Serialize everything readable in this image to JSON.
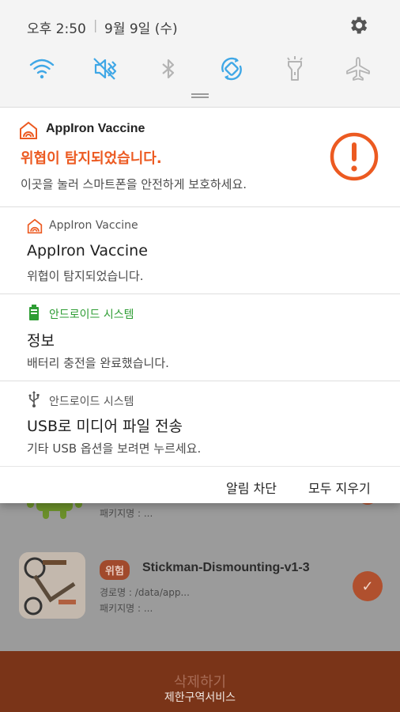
{
  "status_bar": {
    "time": "오후 2:50",
    "separator": "|",
    "date": "9월 9일 (수)"
  },
  "quick_settings": {
    "items": [
      {
        "icon": "wifi-icon",
        "active": true
      },
      {
        "icon": "sound-mute-icon",
        "active": true
      },
      {
        "icon": "bluetooth-icon",
        "active": false
      },
      {
        "icon": "auto-rotate-icon",
        "active": true
      },
      {
        "icon": "flashlight-icon",
        "active": false
      },
      {
        "icon": "airplane-mode-icon",
        "active": false
      }
    ],
    "active_color": "#3fa7e6",
    "inactive_color": "#b4b4b4"
  },
  "notifications": [
    {
      "app": "AppIron Vaccine",
      "title": "위협이 탐지되었습니다.",
      "body": "이곳을 눌러 스마트폰을 안전하게 보호하세요.",
      "icon": "appiron-icon",
      "alert_icon": "exclamation-circle-icon",
      "accent": "#ec5a21"
    },
    {
      "app": "AppIron Vaccine",
      "title": "AppIron Vaccine",
      "body": "위협이 탐지되었습니다.",
      "icon": "appiron-icon"
    },
    {
      "app": "안드로이드 시스템",
      "title": "정보",
      "body": "배터리 충전을 완료했습니다.",
      "icon": "battery-icon",
      "app_color": "#2e9d34"
    },
    {
      "app": "안드로이드 시스템",
      "title": "USB로 미디어 파일 전송",
      "body": "기타 USB 옵션을 보려면 누르세요.",
      "icon": "usb-icon"
    }
  ],
  "actions": {
    "block": "알림 차단",
    "clear_all": "모두 지우기"
  },
  "background_app": {
    "row1_package": "패키지명 : ...",
    "row2_badge": "위험",
    "row2_name": "Stickman-Dismounting-v1-3",
    "row2_path": "경로명 : /data/app...",
    "row2_package": "패키지명 : ...",
    "delete_button": "삭제하기",
    "footer": "제한구역서비스"
  }
}
